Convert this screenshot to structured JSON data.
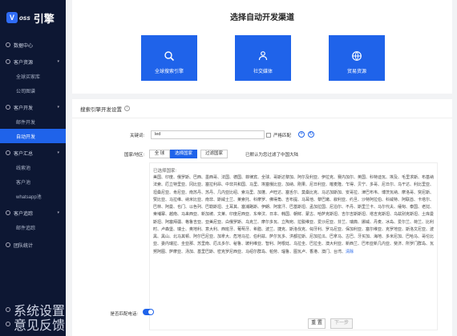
{
  "app": {
    "logo_mark": "V",
    "logo_oss": "oss",
    "brand": "引擎"
  },
  "sidebar": {
    "items": [
      {
        "label": "数据中心",
        "type": "group"
      },
      {
        "label": "客户资源",
        "type": "group",
        "caret": "▾"
      },
      {
        "label": "全球买家库",
        "type": "sub"
      },
      {
        "label": "公司图谱",
        "type": "sub"
      },
      {
        "label": "客户开发",
        "type": "group",
        "caret": "▾"
      },
      {
        "label": "邮件开发",
        "type": "sub"
      },
      {
        "label": "自动开发",
        "type": "sub",
        "active": true
      },
      {
        "label": "客户汇总",
        "type": "group",
        "caret": "▾"
      },
      {
        "label": "线索池",
        "type": "sub"
      },
      {
        "label": "客户池",
        "type": "sub"
      },
      {
        "label": "whatsapp池",
        "type": "sub"
      },
      {
        "label": "客户追踪",
        "type": "group",
        "caret": "▾"
      },
      {
        "label": "邮件追踪",
        "type": "sub"
      },
      {
        "label": "团队统计",
        "type": "group"
      }
    ],
    "bottom": [
      {
        "label": "系统设置"
      },
      {
        "label": "意见反馈"
      }
    ]
  },
  "header": {
    "title": "选择自动开发渠道"
  },
  "channels": [
    {
      "label": "全球搜索引擎",
      "icon": "search-icon"
    },
    {
      "label": "社交媒体",
      "icon": "social-icon"
    },
    {
      "label": "贸易资源",
      "icon": "trade-icon"
    }
  ],
  "form": {
    "title": "搜索引擎开发设置",
    "help": "i",
    "keyword_label": "关键词:",
    "keyword_value": "led",
    "strict_label": "严格匹配",
    "region_label": "国家/地区:",
    "tabs": [
      {
        "label": "全 球"
      },
      {
        "label": "选择国家",
        "selected": true
      },
      {
        "label": "过滤国家"
      }
    ],
    "region_hint": "已默认为您过滤了中国大陆",
    "selected_title": "已选择国家:",
    "countries": "美国、印度、俄罗斯、巴西、墨西哥、法国、德国、菲律宾、全球、哥斯达黎加、阿尔及利亚、伊拉克、赛内加尔、英国、科特迪瓦、埃及、毛里求斯、布基纳法索、厄立特里亚、冈比亚、塞拉利昂、中非共和国、马里、埃塞俄比亚、加纳、刚果、尼日利亚、喀麦隆、乍得、贝宁、多哥、尼日尔、乌干达、利比里亚、坦桑尼亚、肯尼亚、南苏丹、苏丹、几内亚比绍、索马里、加蓬、卢旺达、塞舌尔、莫桑比克、马达加斯加、安哥拉、津巴布韦、博茨瓦纳、摩洛哥、突尼斯、赞比亚、马拉维、纳米比亚、南非、斯威士兰、莱索托、科摩罗、佛得角、吉布提、马耳他、黎巴嫩、叙利亚、约旦、沙特阿拉伯、科威特、阿联酋、卡塔尔、巴林、阿曼、也门、以色列、巴勒斯坦、土耳其、塞浦路斯、伊朗、阿富汗、巴基斯坦、孟加拉国、尼泊尔、不丹、斯里兰卡、马尔代夫、缅甸、泰国、老挝、柬埔寨、越南、马来西亚、新加坡、文莱、印度尼西亚、东帝汶、日本、韩国、朝鲜、蒙古、哈萨克斯坦、吉尔吉斯斯坦、塔吉克斯坦、乌兹别克斯坦、土库曼斯坦、阿塞拜疆、格鲁吉亚、亚美尼亚、白俄罗斯、乌克兰、摩尔多瓦、立陶宛、拉脱维亚、爱沙尼亚、芬兰、瑞典、挪威、丹麦、冰岛、爱尔兰、荷兰、比利时、卢森堡、瑞士、奥地利、意大利、西班牙、葡萄牙、希腊、波兰、捷克、斯洛伐克、匈牙利、罗马尼亚、保加利亚、塞尔维亚、克罗地亚、斯洛文尼亚、波黑、黑山、北马其顿、阿尔巴尼亚、加拿大、危地马拉、伯利兹、萨尔瓦多、洪都拉斯、尼加拉瓜、巴拿马、古巴、牙买加、海地、多米尼加、巴哈马、哥伦比亚、委内瑞拉、圭亚那、苏里南、厄瓜多尔、秘鲁、玻利维亚、智利、阿根廷、乌拉圭、巴拉圭、澳大利亚、新西兰、巴布亚新几内亚、斐济、所罗门群岛、瓦努阿图、萨摩亚、汤加、基里巴斯、密克罗尼西亚、马绍尔群岛、帕劳、瑙鲁、图瓦卢、香港、澳门、台湾、",
    "clear_label": "清除",
    "toggle_label": "是否匹配电话:",
    "reset_label": "重 置",
    "next_label": "下一步"
  },
  "colors": {
    "accent": "#1f63ea",
    "sidebar_bg": "#0d1733"
  }
}
